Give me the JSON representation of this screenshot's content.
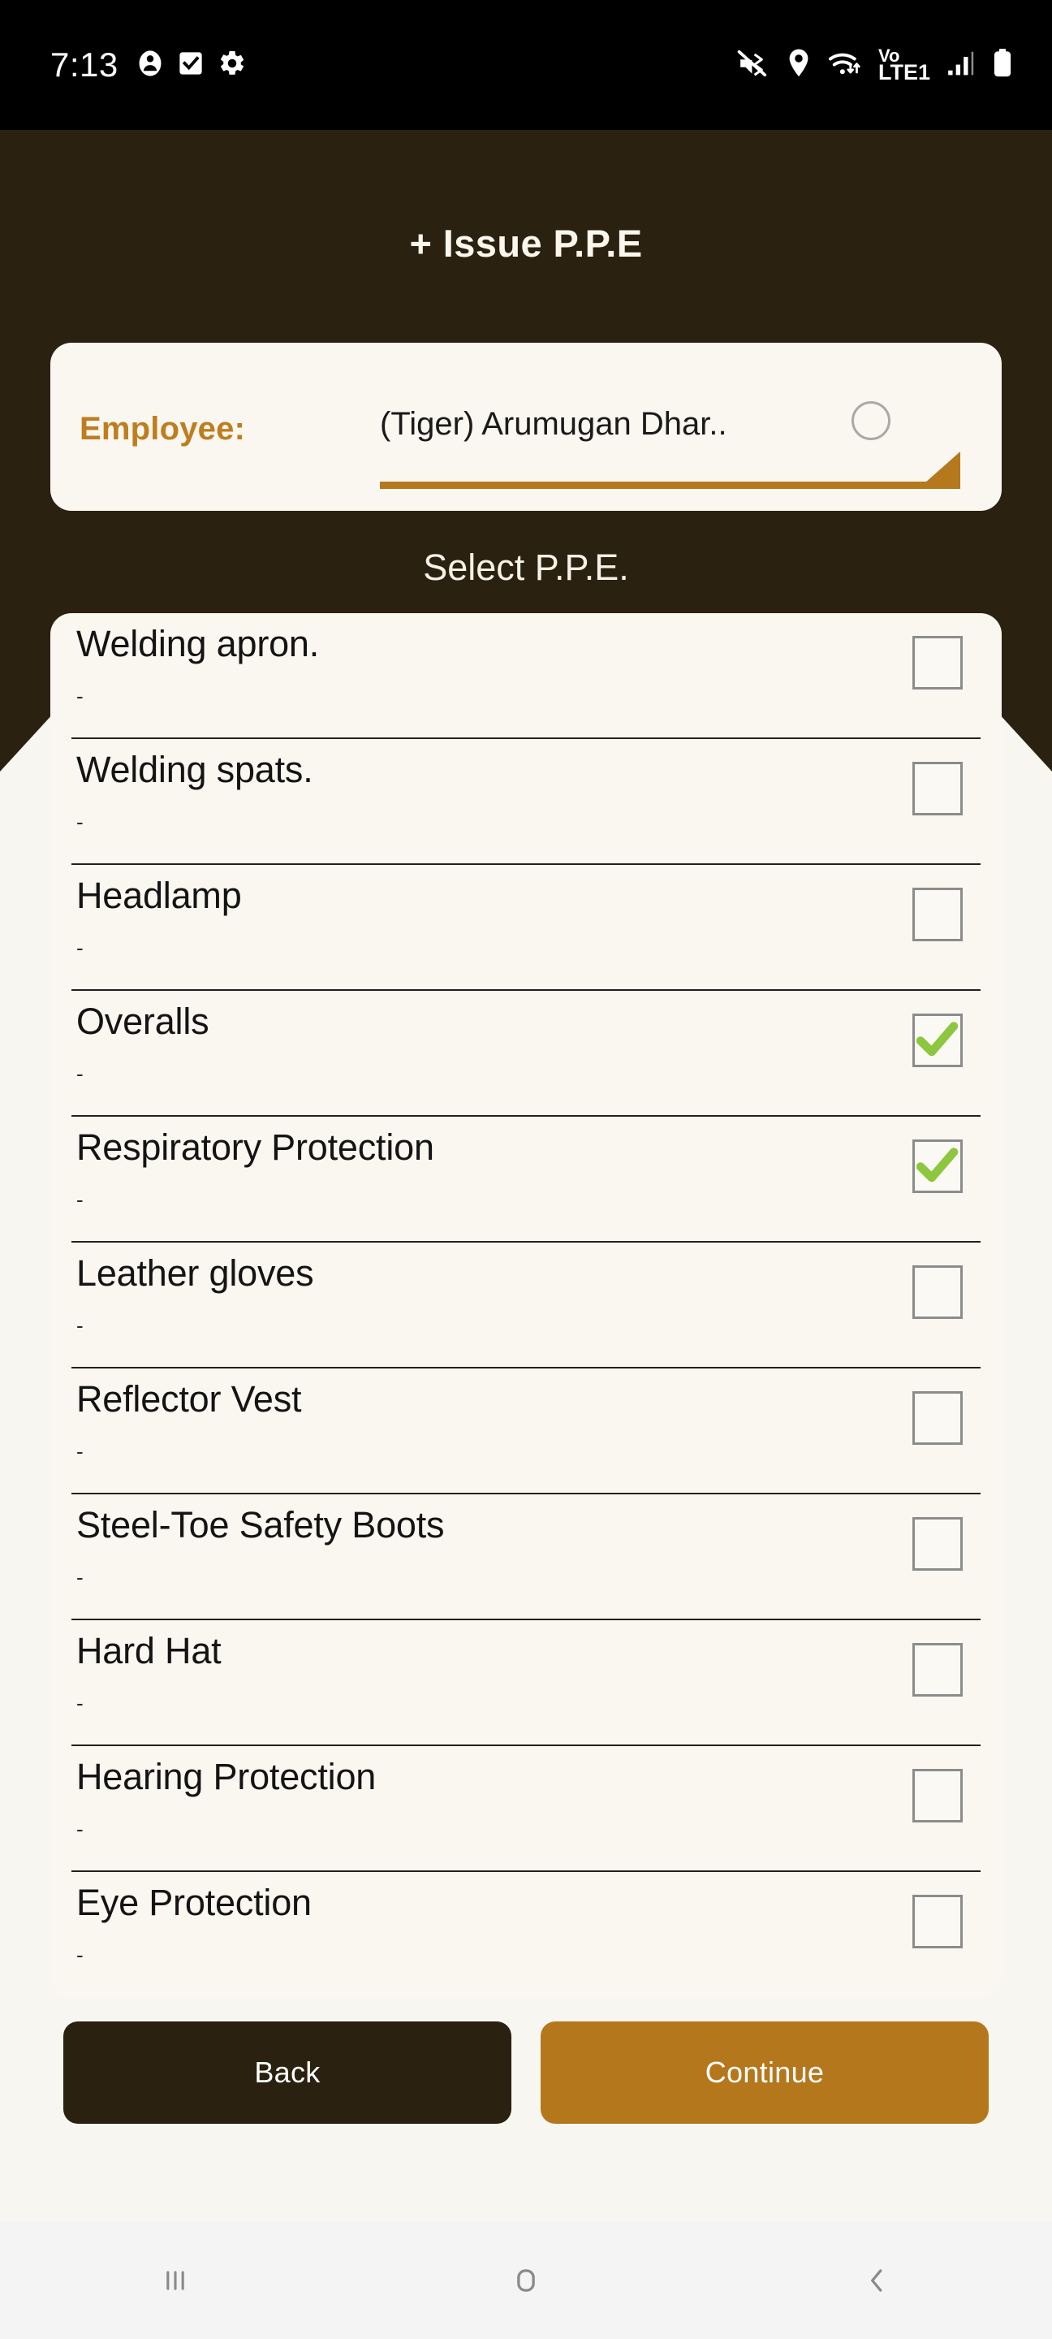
{
  "status_bar": {
    "time": "7:13",
    "left_icons": [
      "person-icon",
      "checkbox-icon",
      "gear-icon"
    ],
    "right_icons": [
      "mute-vibrate-icon",
      "location-pin-icon",
      "wifi-icon",
      "volte-icon",
      "signal-bars-icon",
      "battery-icon"
    ],
    "network_label": "Vo",
    "network_label2": "LTE1"
  },
  "header": {
    "title": "+ Issue P.P.E"
  },
  "employee": {
    "label": "Employee:",
    "value": "(Tiger) Arumugan Dhar..",
    "avatar": "circle-avatar-icon",
    "dropdown": "dropdown-triangle-icon"
  },
  "section": {
    "select_label": "Select P.P.E."
  },
  "ppe_items": [
    {
      "title": "Welding apron.",
      "subtitle": "-",
      "checked": false
    },
    {
      "title": "Welding spats.",
      "subtitle": "-",
      "checked": false
    },
    {
      "title": "Headlamp",
      "subtitle": "-",
      "checked": false
    },
    {
      "title": "Overalls",
      "subtitle": "-",
      "checked": true
    },
    {
      "title": "Respiratory Protection",
      "subtitle": "-",
      "checked": true
    },
    {
      "title": "Leather gloves",
      "subtitle": "-",
      "checked": false
    },
    {
      "title": "Reflector Vest",
      "subtitle": "-",
      "checked": false
    },
    {
      "title": "Steel-Toe Safety Boots",
      "subtitle": "-",
      "checked": false
    },
    {
      "title": "Hard Hat",
      "subtitle": "-",
      "checked": false
    },
    {
      "title": "Hearing Protection",
      "subtitle": "-",
      "checked": false
    },
    {
      "title": "Eye Protection",
      "subtitle": "-",
      "checked": false
    }
  ],
  "actions": {
    "back_label": "Back",
    "continue_label": "Continue"
  },
  "nav_bar": {
    "recents": "recents-icon",
    "home": "home-icon",
    "back": "back-chevron-icon"
  },
  "colors": {
    "dark_brown": "#2B2111",
    "amber": "#B5771C",
    "card_cream": "#FAF7F0",
    "page_background": "#F8F6F0",
    "check_green": "#8DC63F",
    "label_orange": "#BF7D20"
  }
}
